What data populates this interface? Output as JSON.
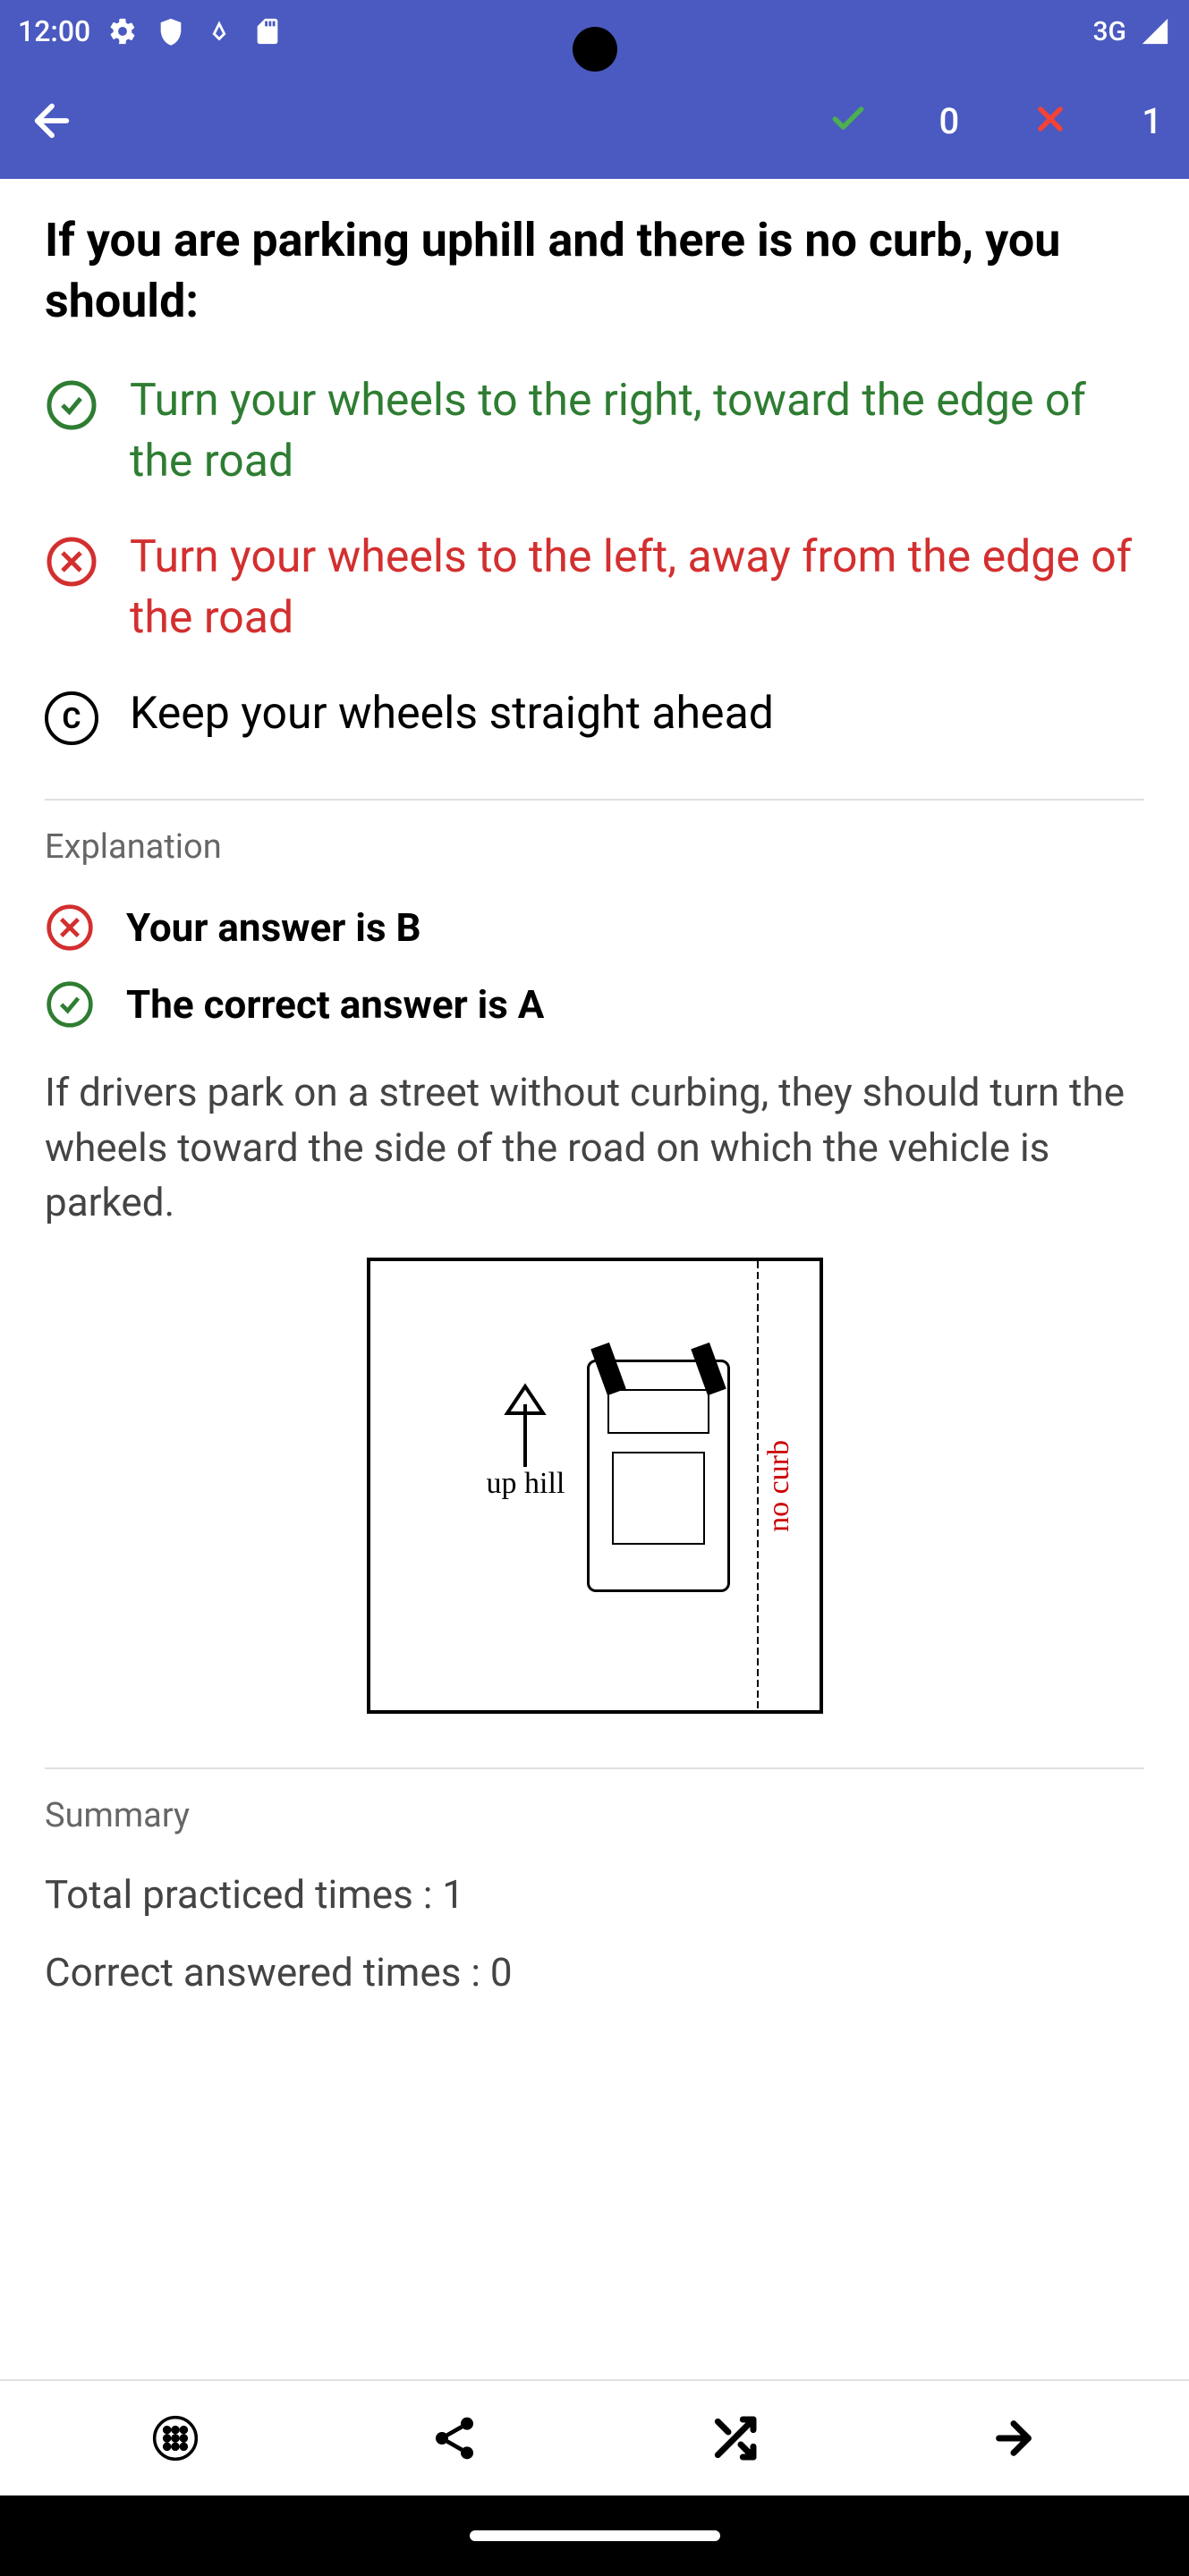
{
  "status": {
    "time": "12:00",
    "network": "3G"
  },
  "appbar": {
    "correct": "0",
    "wrong": "1"
  },
  "question": "If you are parking uphill and there is no curb, you should:",
  "options": {
    "a": "Turn your wheels to the right, toward the edge of the road",
    "b": "Turn your wheels to the left, away from the edge of the road",
    "c": "Keep your wheels straight ahead",
    "c_letter": "C"
  },
  "explanation": {
    "title": "Explanation",
    "your_answer": "Your answer is B",
    "correct_answer": "The correct answer is A",
    "text": "If drivers park on a street without curbing, they should turn the wheels toward the side of the road on which the vehicle is parked."
  },
  "diagram": {
    "uphill": "up hill",
    "nocurb": "no curb"
  },
  "summary": {
    "title": "Summary",
    "practiced_label": "Total practiced times : ",
    "practiced_value": "1",
    "correct_label": "Correct answered times : ",
    "correct_value": "0"
  }
}
